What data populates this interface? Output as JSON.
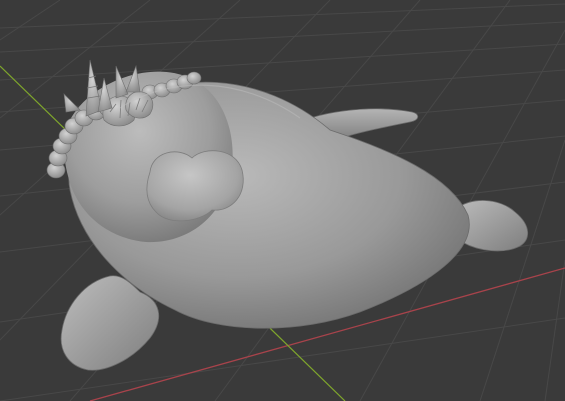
{
  "viewport": {
    "background_color": "#3a3a3a",
    "grid_color": "#4a4a4a",
    "grid_color_minor": "#434343",
    "x_axis_color": "#a8434b",
    "y_axis_color": "#7fa62c"
  },
  "scene": {
    "object_kind": "sculpted-seal-with-shell-crown",
    "material_color": "#9a9a9a",
    "highlight_color": "#bdbdbd",
    "shadow_color": "#6e6e6e"
  }
}
